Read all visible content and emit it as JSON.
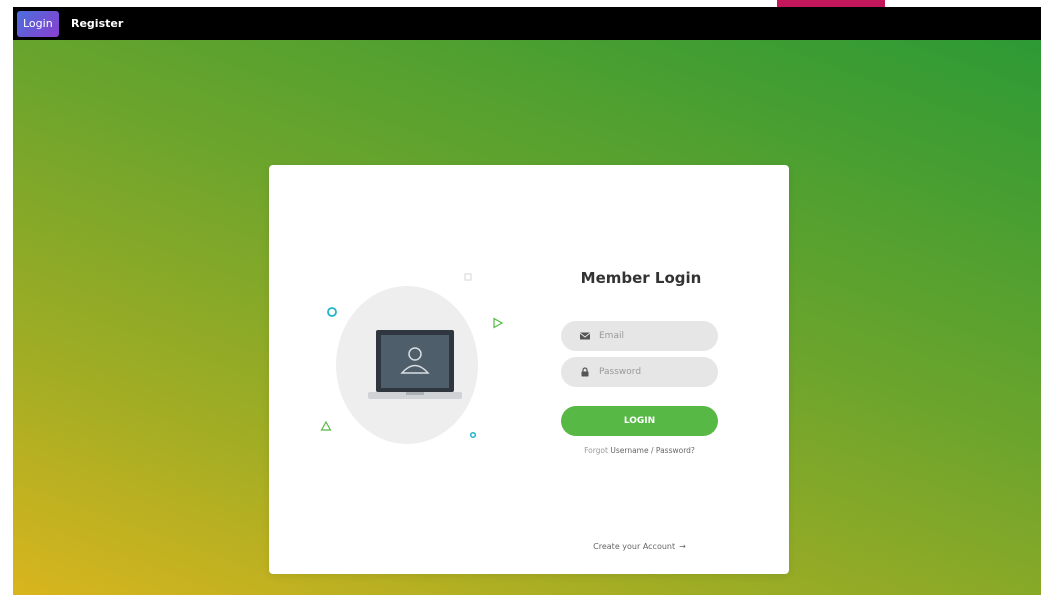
{
  "nav": {
    "login_label": "Login",
    "register_label": "Register"
  },
  "form": {
    "title": "Member Login",
    "email_placeholder": "Email",
    "password_placeholder": "Password",
    "login_button": "LOGIN",
    "forgot_prefix": "Forgot",
    "forgot_link": "Username / Password?",
    "create_account": "Create your Account",
    "create_arrow": "→"
  },
  "icons": {
    "email": "envelope-icon",
    "password": "lock-icon",
    "illustration": "laptop-user-icon"
  },
  "colors": {
    "topbar": "#000000",
    "accent": "#c2185b",
    "login_button": "#57b846",
    "field_bg": "#e6e6e6",
    "gradient_start": "#d9b51e",
    "gradient_end": "#2d9a35"
  }
}
